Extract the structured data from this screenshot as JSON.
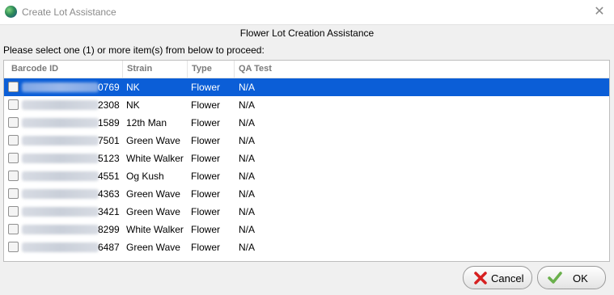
{
  "window": {
    "title": "Create Lot Assistance",
    "app_icon": "globe-icon",
    "close_icon": "close-icon",
    "close_glyph": "✕"
  },
  "dialog": {
    "heading": "Flower Lot Creation Assistance",
    "instruction": "Please select one (1) or more item(s) from below to proceed:"
  },
  "table": {
    "columns": [
      "Barcode ID",
      "Strain",
      "Type",
      "QA Test"
    ],
    "selected_row_index": 0,
    "rows": [
      {
        "barcode_suffix": "0769",
        "strain": "NK",
        "type": "Flower",
        "qa": "N/A",
        "checked": false
      },
      {
        "barcode_suffix": "2308",
        "strain": "NK",
        "type": "Flower",
        "qa": "N/A",
        "checked": false
      },
      {
        "barcode_suffix": "1589",
        "strain": "12th Man",
        "type": "Flower",
        "qa": "N/A",
        "checked": false
      },
      {
        "barcode_suffix": "7501",
        "strain": "Green Wave",
        "type": "Flower",
        "qa": "N/A",
        "checked": false
      },
      {
        "barcode_suffix": "5123",
        "strain": "White Walker",
        "type": "Flower",
        "qa": "N/A",
        "checked": false
      },
      {
        "barcode_suffix": "4551",
        "strain": "Og Kush",
        "type": "Flower",
        "qa": "N/A",
        "checked": false
      },
      {
        "barcode_suffix": "4363",
        "strain": "Green Wave",
        "type": "Flower",
        "qa": "N/A",
        "checked": false
      },
      {
        "barcode_suffix": "3421",
        "strain": "Green Wave",
        "type": "Flower",
        "qa": "N/A",
        "checked": false
      },
      {
        "barcode_suffix": "8299",
        "strain": "White Walker",
        "type": "Flower",
        "qa": "N/A",
        "checked": false
      },
      {
        "barcode_suffix": "6487",
        "strain": "Green Wave",
        "type": "Flower",
        "qa": "N/A",
        "checked": false
      }
    ]
  },
  "buttons": {
    "cancel": {
      "label": "Cancel",
      "icon": "red-x-icon"
    },
    "ok": {
      "label": "OK",
      "icon": "green-check-icon"
    }
  },
  "colors": {
    "selection": "#0b5ed7",
    "cancel_icon": "#d62020",
    "ok_icon": "#6ab04c"
  }
}
